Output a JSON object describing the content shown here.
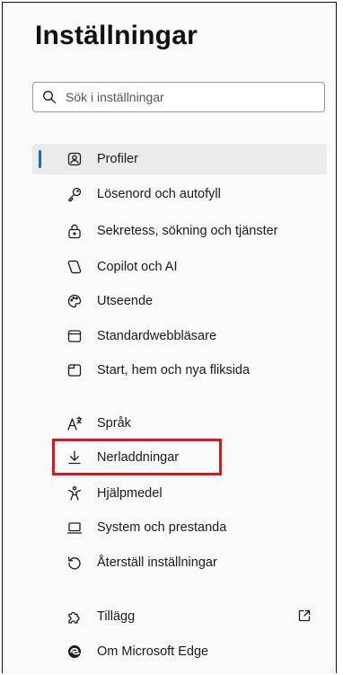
{
  "title": "Inställningar",
  "search": {
    "placeholder": "Sök i inställningar",
    "icon": "search-icon"
  },
  "accent_color": "#0f6cbd",
  "highlight_color": "#e0141c",
  "nav": {
    "items": [
      {
        "label": "Profiler",
        "icon": "profile-icon",
        "active": true
      },
      {
        "label": "Lösenord och autofyll",
        "icon": "key-icon"
      },
      {
        "label": "Sekretess, sökning och tjänster",
        "icon": "lock-icon"
      },
      {
        "label": "Copilot och AI",
        "icon": "copilot-icon"
      },
      {
        "label": "Utseende",
        "icon": "palette-icon"
      },
      {
        "label": "Standardwebbläsare",
        "icon": "browser-icon"
      },
      {
        "label": "Start, hem och nya fliksida",
        "icon": "home-page-icon"
      },
      {
        "label": "Språk",
        "icon": "language-icon"
      },
      {
        "label": "Nerladdningar",
        "icon": "download-icon",
        "highlighted": true
      },
      {
        "label": "Hjälpmedel",
        "icon": "accessibility-icon"
      },
      {
        "label": "System och prestanda",
        "icon": "laptop-icon"
      },
      {
        "label": "Återställ inställningar",
        "icon": "reset-icon"
      },
      {
        "label": "Tillägg",
        "icon": "extensions-icon",
        "external": true
      },
      {
        "label": "Om Microsoft Edge",
        "icon": "edge-logo-icon"
      }
    ]
  }
}
